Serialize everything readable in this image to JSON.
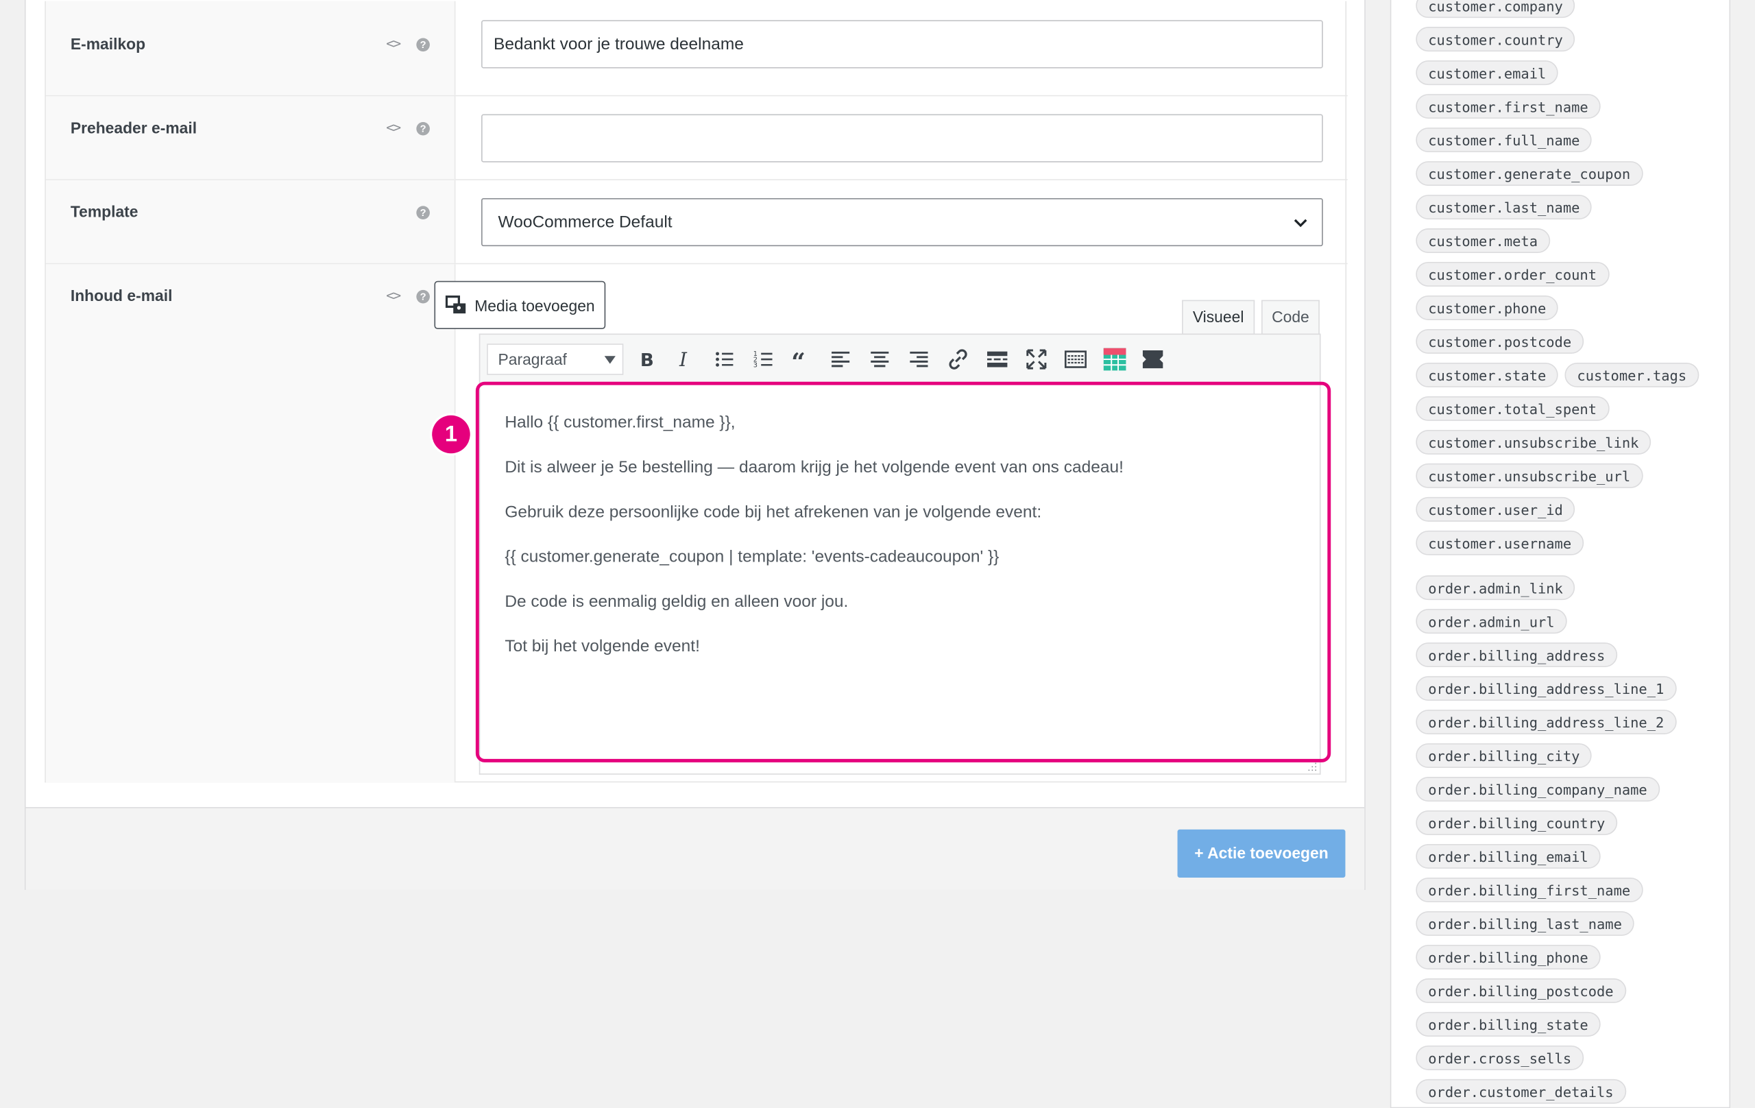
{
  "fields": {
    "subject": {
      "label": "E-mailkop",
      "value": "Bedankt voor je trouwe deelname"
    },
    "preheader": {
      "label": "Preheader e-mail",
      "value": ""
    },
    "template": {
      "label": "Template",
      "selected": "WooCommerce Default"
    },
    "content": {
      "label": "Inhoud e-mail"
    }
  },
  "editor": {
    "media_button": "Media toevoegen",
    "tab_visual": "Visueel",
    "tab_code": "Code",
    "format_select": "Paragraaf",
    "paragraphs": [
      "Hallo {{ customer.first_name }},",
      "Dit is alweer je 5e bestelling — daarom krijg je het volgende event van ons cadeau!",
      "Gebruik deze persoonlijke code bij het afrekenen van je volgende event:",
      "{{ customer.generate_coupon | template: 'events-cadeaucoupon' }}",
      "De code is eenmalig geldig en alleen voor jou.",
      "Tot bij het volgende event!"
    ]
  },
  "annotation": {
    "step": "1",
    "color": "#e5007d"
  },
  "actions": {
    "add_action": "+ Actie toevoegen",
    "add_action_color": "#72aee6"
  },
  "variables": [
    "customer.company",
    "customer.country",
    "customer.email",
    "customer.first_name",
    "customer.full_name",
    "customer.generate_coupon",
    "customer.last_name",
    "customer.meta",
    "customer.order_count",
    "customer.phone",
    "customer.postcode",
    "customer.state",
    "customer.tags",
    "customer.total_spent",
    "customer.unsubscribe_link",
    "customer.unsubscribe_url",
    "customer.user_id",
    "customer.username",
    "order.admin_link",
    "order.admin_url",
    "order.billing_address",
    "order.billing_address_line_1",
    "order.billing_address_line_2",
    "order.billing_city",
    "order.billing_company_name",
    "order.billing_country",
    "order.billing_email",
    "order.billing_first_name",
    "order.billing_last_name",
    "order.billing_phone",
    "order.billing_postcode",
    "order.billing_state",
    "order.cross_sells",
    "order.customer_details"
  ]
}
